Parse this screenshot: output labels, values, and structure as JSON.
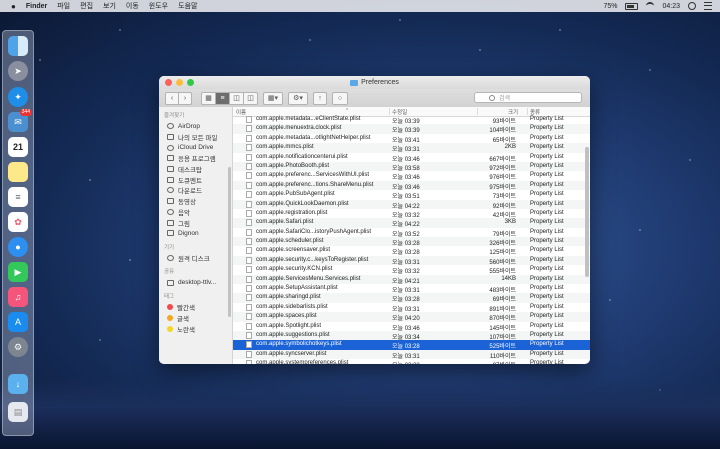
{
  "menubar": {
    "app": "Finder",
    "menus": [
      "파일",
      "편집",
      "보기",
      "이동",
      "윈도우",
      "도움말"
    ],
    "battery": "75%",
    "clock": "04:23",
    "battery_level": 0.75
  },
  "dock": {
    "icons": [
      "finder-icon",
      "launchpad-icon",
      "safari-icon",
      "mail-icon",
      "calendar-icon",
      "notes-icon",
      "reminders-icon",
      "photos-icon",
      "messages-icon",
      "facetime-icon",
      "music-icon",
      "app-store-icon",
      "system-preferences-icon",
      "downloads-folder-icon",
      "trash-icon"
    ],
    "mail_badge": "344",
    "calendar_day": "21"
  },
  "window": {
    "title": "Preferences",
    "search_placeholder": "검색"
  },
  "sidebar": {
    "favorites_header": "즐겨찾기",
    "favorites": [
      "AirDrop",
      "나의 모든 파일",
      "iCloud Drive",
      "응용 프로그램",
      "데스크탑",
      "도큐멘트",
      "다운로드",
      "동영상",
      "음악",
      "그림",
      "Dignon"
    ],
    "devices_header": "기기",
    "devices": [
      "원격 디스크"
    ],
    "shared_header": "공유",
    "shared": [
      "desktop-ttlv..."
    ],
    "tags_header": "태그",
    "tags": [
      {
        "label": "빨간색",
        "color": "#f24a4a"
      },
      {
        "label": "글색",
        "color": "#f5a623"
      },
      {
        "label": "노란색",
        "color": "#f5d623"
      }
    ]
  },
  "list": {
    "columns": {
      "name": "이름",
      "date": "수정일",
      "size": "크기",
      "kind": "종류"
    },
    "rows": [
      {
        "name": "com.apple.metadata...eClientState.plist",
        "date": "오늘 03:39",
        "size": "93바이트",
        "kind": "Property List"
      },
      {
        "name": "com.apple.menuextra.clock.plist",
        "date": "오늘 03:39",
        "size": "104바이트",
        "kind": "Property List"
      },
      {
        "name": "com.apple.metadata...otlightNetHelper.plist",
        "date": "오늘 03:41",
        "size": "65바이트",
        "kind": "Property List"
      },
      {
        "name": "com.apple.mmcs.plist",
        "date": "오늘 03:31",
        "size": "2KB",
        "kind": "Property List"
      },
      {
        "name": "com.apple.notificationcenterui.plist",
        "date": "오늘 03:46",
        "size": "667바이트",
        "kind": "Property List"
      },
      {
        "name": "com.apple.PhotoBooth.plist",
        "date": "오늘 03:58",
        "size": "972바이트",
        "kind": "Property List"
      },
      {
        "name": "com.apple.preferenc...ServicesWithUI.plist",
        "date": "오늘 03:46",
        "size": "976바이트",
        "kind": "Property List"
      },
      {
        "name": "com.apple.preferenc...tions.ShareMenu.plist",
        "date": "오늘 03:46",
        "size": "975바이트",
        "kind": "Property List"
      },
      {
        "name": "com.apple.PubSubAgent.plist",
        "date": "오늘 03:51",
        "size": "73바이트",
        "kind": "Property List"
      },
      {
        "name": "com.apple.QuickLookDaemon.plist",
        "date": "오늘 04:22",
        "size": "92바이트",
        "kind": "Property List"
      },
      {
        "name": "com.apple.registration.plist",
        "date": "오늘 03:32",
        "size": "42바이트",
        "kind": "Property List"
      },
      {
        "name": "com.apple.Safari.plist",
        "date": "오늘 04:22",
        "size": "3KB",
        "kind": "Property List"
      },
      {
        "name": "com.apple.SafariClo...istoryPushAgent.plist",
        "date": "오늘 03:52",
        "size": "79바이트",
        "kind": "Property List"
      },
      {
        "name": "com.apple.scheduler.plist",
        "date": "오늘 03:28",
        "size": "326바이트",
        "kind": "Property List"
      },
      {
        "name": "com.apple.screensaver.plist",
        "date": "오늘 03:28",
        "size": "125바이트",
        "kind": "Property List"
      },
      {
        "name": "com.apple.security.c...keysToRegister.plist",
        "date": "오늘 03:31",
        "size": "560바이트",
        "kind": "Property List"
      },
      {
        "name": "com.apple.security.KCN.plist",
        "date": "오늘 03:32",
        "size": "555바이트",
        "kind": "Property List"
      },
      {
        "name": "com.apple.ServicesMenu.Services.plist",
        "date": "오늘 04:21",
        "size": "14KB",
        "kind": "Property List"
      },
      {
        "name": "com.apple.SetupAssistant.plist",
        "date": "오늘 03:31",
        "size": "483바이트",
        "kind": "Property List"
      },
      {
        "name": "com.apple.sharingd.plist",
        "date": "오늘 03:28",
        "size": "69바이트",
        "kind": "Property List"
      },
      {
        "name": "com.apple.sidebarlists.plist",
        "date": "오늘 03:31",
        "size": "891바이트",
        "kind": "Property List"
      },
      {
        "name": "com.apple.spaces.plist",
        "date": "오늘 04:20",
        "size": "870바이트",
        "kind": "Property List"
      },
      {
        "name": "com.apple.Spotlight.plist",
        "date": "오늘 03:46",
        "size": "145바이트",
        "kind": "Property List"
      },
      {
        "name": "com.apple.suggestions.plist",
        "date": "오늘 03:34",
        "size": "107바이트",
        "kind": "Property List"
      },
      {
        "name": "com.apple.symbolichotkeys.plist",
        "date": "오늘 03:28",
        "size": "525바이트",
        "kind": "Property List",
        "selected": true
      },
      {
        "name": "com.apple.syncserver.plist",
        "date": "오늘 03:31",
        "size": "110바이트",
        "kind": "Property List"
      },
      {
        "name": "com.apple.systempreferences.plist",
        "date": "오늘 03:28",
        "size": "97바이트",
        "kind": "Property List"
      }
    ]
  }
}
